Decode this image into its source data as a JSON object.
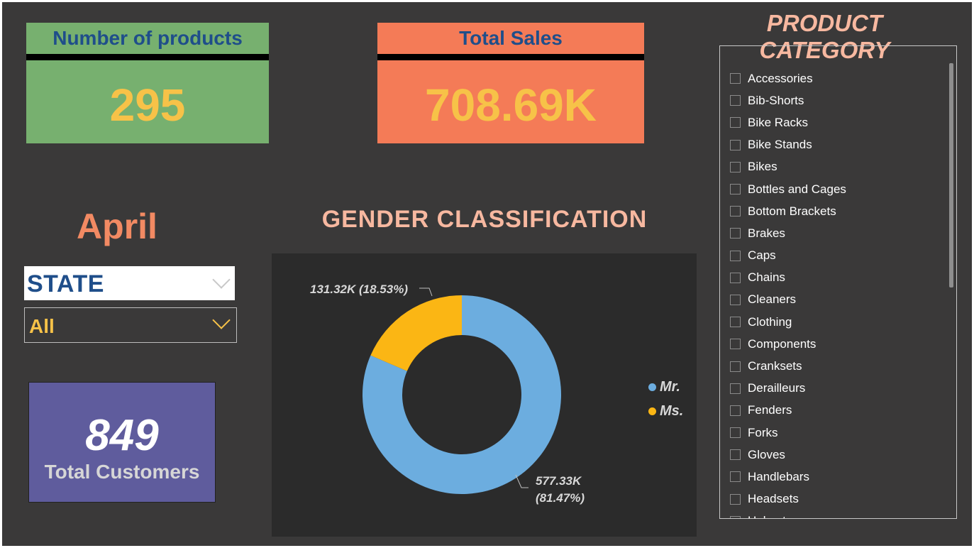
{
  "kpis": {
    "products": {
      "title": "Number of products",
      "value": "295"
    },
    "sales": {
      "title": "Total Sales",
      "value": "708.69K"
    }
  },
  "month": "April",
  "state_filter": {
    "label": "STATE",
    "selected": "All"
  },
  "customers": {
    "value": "849",
    "label": "Total Customers"
  },
  "gender": {
    "title": "GENDER CLASSIFICATION",
    "legend": [
      {
        "name": "Mr.",
        "color": "#6caddf"
      },
      {
        "name": "Ms.",
        "color": "#fbb614"
      }
    ],
    "labels": {
      "ms": "131.32K (18.53%)",
      "mr_line1": "577.33K",
      "mr_line2": "(81.47%)"
    }
  },
  "chart_data": {
    "type": "pie",
    "title": "GENDER CLASSIFICATION",
    "labels": [
      "Mr.",
      "Ms."
    ],
    "values": [
      577.33,
      131.32
    ],
    "percent": [
      81.47,
      18.53
    ],
    "colors": [
      "#6caddf",
      "#fbb614"
    ],
    "donut": true,
    "legend": "right"
  },
  "product_category": {
    "title": "PRODUCT CATEGORY",
    "items": [
      "Accessories",
      "Bib-Shorts",
      "Bike Racks",
      "Bike Stands",
      "Bikes",
      "Bottles and Cages",
      "Bottom Brackets",
      "Brakes",
      "Caps",
      "Chains",
      "Cleaners",
      "Clothing",
      "Components",
      "Cranksets",
      "Derailleurs",
      "Fenders",
      "Forks",
      "Gloves",
      "Handlebars",
      "Headsets",
      "Helmets"
    ]
  }
}
